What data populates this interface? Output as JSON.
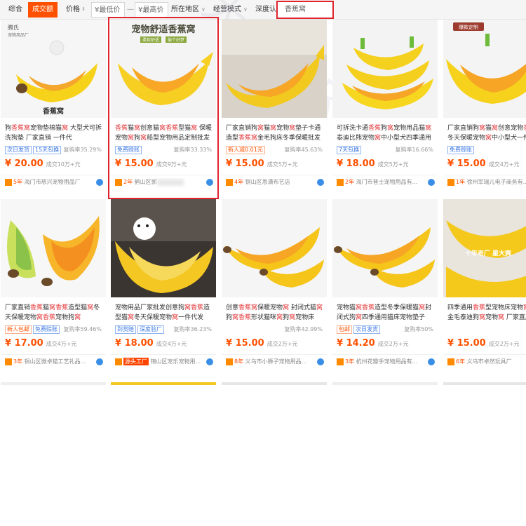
{
  "filter_bar": {
    "tab_overall": "综合",
    "tab_volume": "成交额",
    "tab_price": "价格",
    "min_price_placeholder": "¥最低价",
    "max_price_placeholder": "¥最高价",
    "dash": "—",
    "location": "所在地区",
    "business_mode": "经营模式",
    "certification": "深度认证",
    "search_value": "香蕉窝"
  },
  "overlay_texts": {
    "card2_banner": "宠物舒适香蕉窝",
    "card2_sub1": "柔软舒适",
    "card2_sub2": "偷个好梦",
    "card1_brand": "腾氏",
    "card1_brand_sub": "宠物用品厂",
    "card1_caption": "香蕉窝",
    "card5_badge": "爆款定制",
    "card10_banner": "十年老厂  星大爽"
  },
  "watermark": "大 易 ERP",
  "products": [
    {
      "title": "狗香蕉窝宠物垫棉猫窝 大型犬可拆洗狗垫 厂家直销 一件代",
      "tags": [
        "次日发货",
        "15天包换"
      ],
      "rate": "复购率35.29%",
      "price": "¥ 20.00",
      "sales": "成交10万+元",
      "years": "5年",
      "shop": "海门市慈兴宠物用品厂"
    },
    {
      "title": "香蕉猫窝创意猫窝香蕉型猫窝 保暖宠物窝狗窝船型宠物用品定制批发",
      "tags": [
        "免费赊账"
      ],
      "rate": "复购率33.33%",
      "price": "¥ 15.00",
      "sales": "成交9万+元",
      "years": "2年",
      "shop": "鹤山区郭"
    },
    {
      "title": "厂家直销狗窝猫窝宠物窝垫子卡通造型香蕉窝金毛狗床冬季保暖批发",
      "tags": [
        "新人减0.01元"
      ],
      "rate": "复购率45.63%",
      "price": "¥ 15.00",
      "sales": "成交5万+元",
      "years": "4年",
      "shop": "铜山区恩潇布艺店"
    },
    {
      "title": "可拆洗卡通香蕉狗窝宠物用品猫窝泰迪比熊宠物窝中小型犬四季通用",
      "tags": [
        "7天包换"
      ],
      "rate": "复购率16.66%",
      "price": "¥ 18.00",
      "sales": "成交5万+元",
      "years": "2年",
      "shop": "海门市普士宠物用品有..."
    },
    {
      "title": "厂家直销狗窝猫窝创意宠物香蕉窝冬天保暖宠物窝中小型犬一件代发",
      "tags": [
        "免费赊账"
      ],
      "rate": "",
      "price": "¥ 15.00",
      "sales": "成交4万+元",
      "years": "1年",
      "shop": "徐州军瑞儿电子商务有..."
    },
    {
      "title": "厂家直销香蕉猫窝香蕉造型猫窝冬天保暖宠物窝香蕉宠物狗窝",
      "tags": [
        "新人包邮",
        "免费赊账"
      ],
      "rate": "复购率59.46%",
      "price": "¥ 17.00",
      "sales": "成交4万+元",
      "years": "3年",
      "shop": "铜山区微卓猫工艺礼品..."
    },
    {
      "title": "宠物用品厂家批发创意狗窝香蕉造型猫窝冬天保暖宠物窝一件代发",
      "tags": [
        "到货赔",
        "深度验厂"
      ],
      "rate": "复购率36.23%",
      "price": "¥ 18.00",
      "sales": "成交4万+元",
      "years": "源头工厂",
      "shop": "锦山区宠乐宠物用..."
    },
    {
      "title": "创意香蕉窝保暖宠物窝 封闭式猫窝狗窝香蕉形状猫咪窝狗窝宠物床",
      "tags": [],
      "rate": "复购率42.99%",
      "price": "¥ 15.00",
      "sales": "成交2万+元",
      "years": "8年",
      "shop": "义乌市小狮子宠物用品..."
    },
    {
      "title": "宠物猫窝香蕉造型冬季保暖猫窝封闭式狗窝四季通用猫床宠物垫子",
      "tags": [
        "包邮",
        "次日发货"
      ],
      "rate": "复购率50%",
      "price": "¥ 14.20",
      "sales": "成交2万+元",
      "years": "3年",
      "shop": "杭州花瓣手宠物用品有..."
    },
    {
      "title": "四季通用香蕉型宠物床宠物窝 狗窝金毛泰迪狗窝宠物窝 厂家直产",
      "tags": [],
      "rate": "",
      "price": "¥ 15.00",
      "sales": "成交2万+元",
      "years": "6年",
      "shop": "义乌市卓然玩具厂"
    }
  ]
}
